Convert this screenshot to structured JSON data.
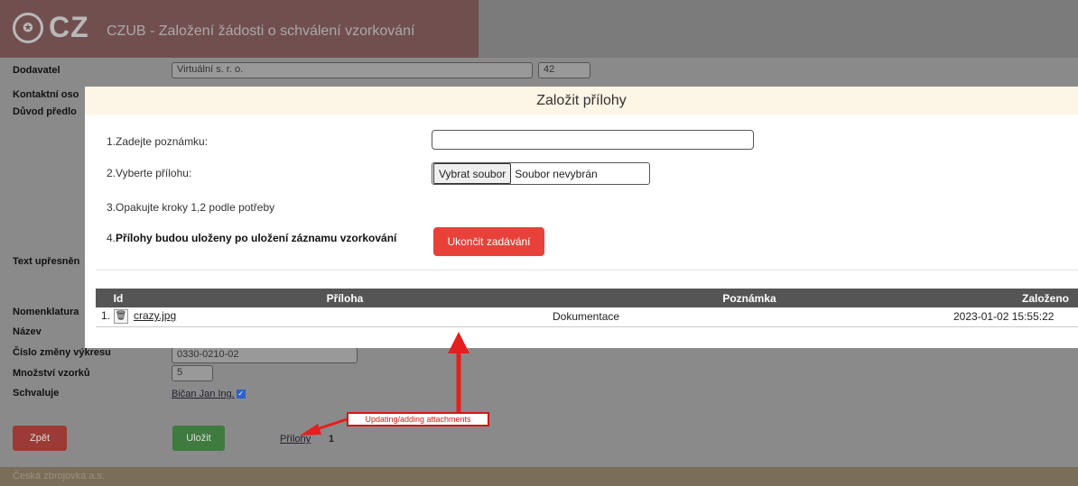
{
  "banner": {
    "logo_mark": "CZ",
    "logo_text": "CZ",
    "title": "CZUB - Založení žádosti o schválení vzorkování"
  },
  "form": {
    "labels": {
      "supplier": "Dodavatel",
      "contact": "Kontaktní oso",
      "reason": "Důvod předlo",
      "text_detail": "Text upřesněn",
      "nomenclature": "Nomenklatura",
      "name": "Název",
      "drawing_change": "Číslo změny výkresu",
      "sample_qty": "Množství vzorků",
      "approver_label": "Schvaluje"
    },
    "values": {
      "supplier": "Virtuální s. r. o.",
      "supplier_code": "42",
      "drawing_change": "0330-0210-02",
      "sample_qty": "5",
      "approver": "Bičan Jan Ing."
    }
  },
  "buttons": {
    "back": "Zpět",
    "save": "Uložit",
    "attachments_link": "Přílohy",
    "attachments_count": "1"
  },
  "footer": {
    "text": "Česká zbrojovka a.s."
  },
  "modal": {
    "title": "Založit přílohy",
    "step1": "1.Zadejte poznámku:",
    "step2": "2.Vyberte přílohu:",
    "step3": "3.Opakujte kroky 1,2 podle potřeby",
    "step4_prefix": "4.",
    "step4_bold": "Přílohy budou uloženy po uložení záznamu vzorkování",
    "note_value": "",
    "file_button": "Vybrat soubor",
    "file_status": "Soubor nevybrán",
    "finish_button": "Ukončit zadávání",
    "table": {
      "headers": [
        "Id",
        "Příloha",
        "Poznámka",
        "Založeno"
      ],
      "rows": [
        {
          "id": "1.",
          "file": "crazy.jpg",
          "note": "Dokumentace",
          "created": "2023-01-02 15:55:22"
        }
      ]
    }
  },
  "annotation": {
    "label": "Updating/adding attachments",
    "color": "#d01818"
  }
}
